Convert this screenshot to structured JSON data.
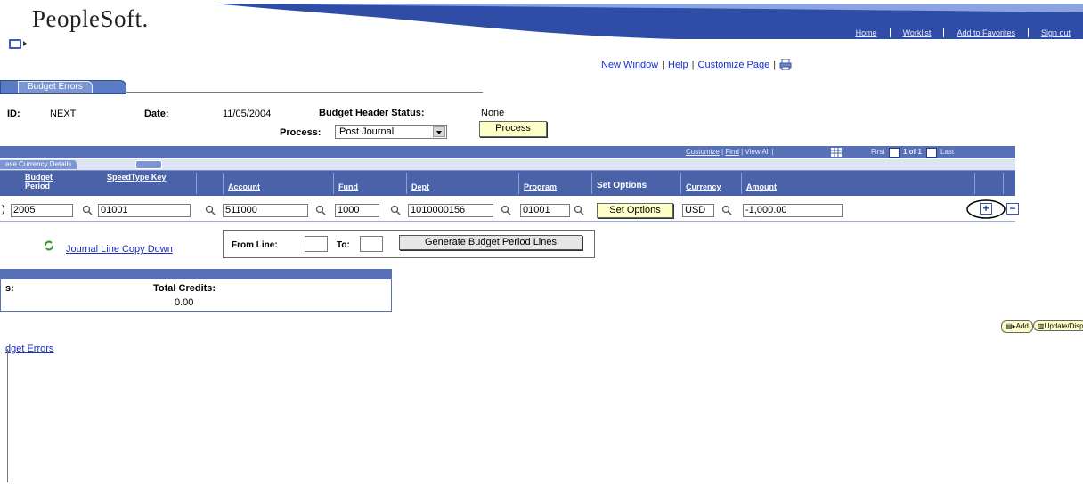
{
  "app": {
    "logo": "PeopleSoft."
  },
  "topnav": [
    "Home",
    "Worklist",
    "Add to Favorites",
    "Sign out"
  ],
  "header_links": {
    "new_window": "New Window",
    "help": "Help",
    "customize_page": "Customize Page",
    "sep": "|"
  },
  "tab": {
    "label": "Budget Errors"
  },
  "fields": {
    "id_label": "ID:",
    "id_value": "NEXT",
    "date_label": "Date:",
    "date_value": "11/05/2004",
    "status_label": "Budget Header Status:",
    "status_value": "None",
    "process_label": "Process:",
    "process_value": "Post Journal",
    "process_button": "Process"
  },
  "grid": {
    "toolbar": {
      "customize": "Customize",
      "find": "Find",
      "view_all": "View All",
      "first": "First",
      "count": "1 of 1",
      "last": "Last"
    },
    "subtab": "ase Currency Details",
    "columns": {
      "budget_period": "Budget Period",
      "speedtype_key": "SpeedType Key",
      "account": "Account",
      "fund": "Fund",
      "dept": "Dept",
      "program": "Program",
      "set_options": "Set Options",
      "currency": "Currency",
      "amount": "Amount"
    },
    "row": {
      "lead": ")",
      "budget_period": "2005",
      "speedtype_key": "01001",
      "account": "511000",
      "fund": "1000",
      "dept": "1010000156",
      "program": "01001",
      "set_options_button": "Set Options",
      "currency": "USD",
      "amount": "-1,000.00",
      "add_row": "+",
      "delete_row": "−"
    }
  },
  "copy_down": {
    "link": "Journal Line Copy Down",
    "from_label": "From Line:",
    "to_label": "To:",
    "generate_button": "Generate Budget Period Lines"
  },
  "totals": {
    "left_label": "s:",
    "credits_label": "Total Credits:",
    "credits_value": "0.00"
  },
  "actions": {
    "add": "Add",
    "update": "Update/Displa"
  },
  "bottom_link": "dget Errors",
  "colors": {
    "accent": "#4a63a8",
    "button_bg": "#ffffc8",
    "link": "#1a2ebf"
  }
}
